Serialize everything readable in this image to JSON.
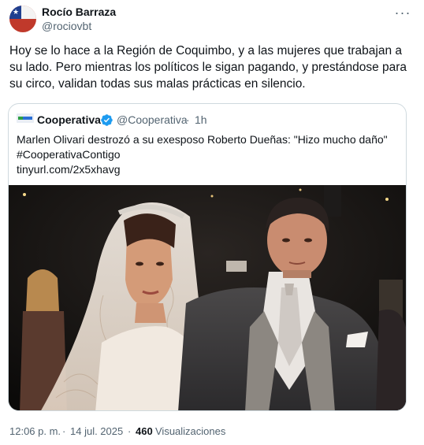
{
  "author": {
    "name": "Rocío Barraza",
    "handle": "@rociovbt"
  },
  "more_icon": "ellipsis-icon",
  "tweet": {
    "text": "Hoy se lo hace a la Región de Coquimbo, y a las mujeres que trabajan a\nsu lado. Pero mientras los políticos le sigan pagando, y prestándose para\nsu circo, validan todas sus malas prácticas en silencio."
  },
  "quoted": {
    "name": "Cooperativa",
    "handle": "@Cooperativa",
    "separator": "·",
    "time": "1h",
    "verified_icon": "verified-badge-icon",
    "lines": [
      "Marlen Olivari destrozó a su exesposo Roberto Dueñas: \"Hizo mucho daño\"",
      "#CooperativaContigo",
      "tinyurl.com/2x5xhavg"
    ]
  },
  "footer": {
    "time": "12:06 p. m.",
    "separator": "·",
    "date": "14 jul. 2025",
    "separator2": "·",
    "views_count": "460",
    "views_label": "Visualizaciones"
  },
  "colors": {
    "text_primary": "#0f1419",
    "text_secondary": "#536471",
    "border": "#cfd9de",
    "verified": "#1d9bf0"
  }
}
